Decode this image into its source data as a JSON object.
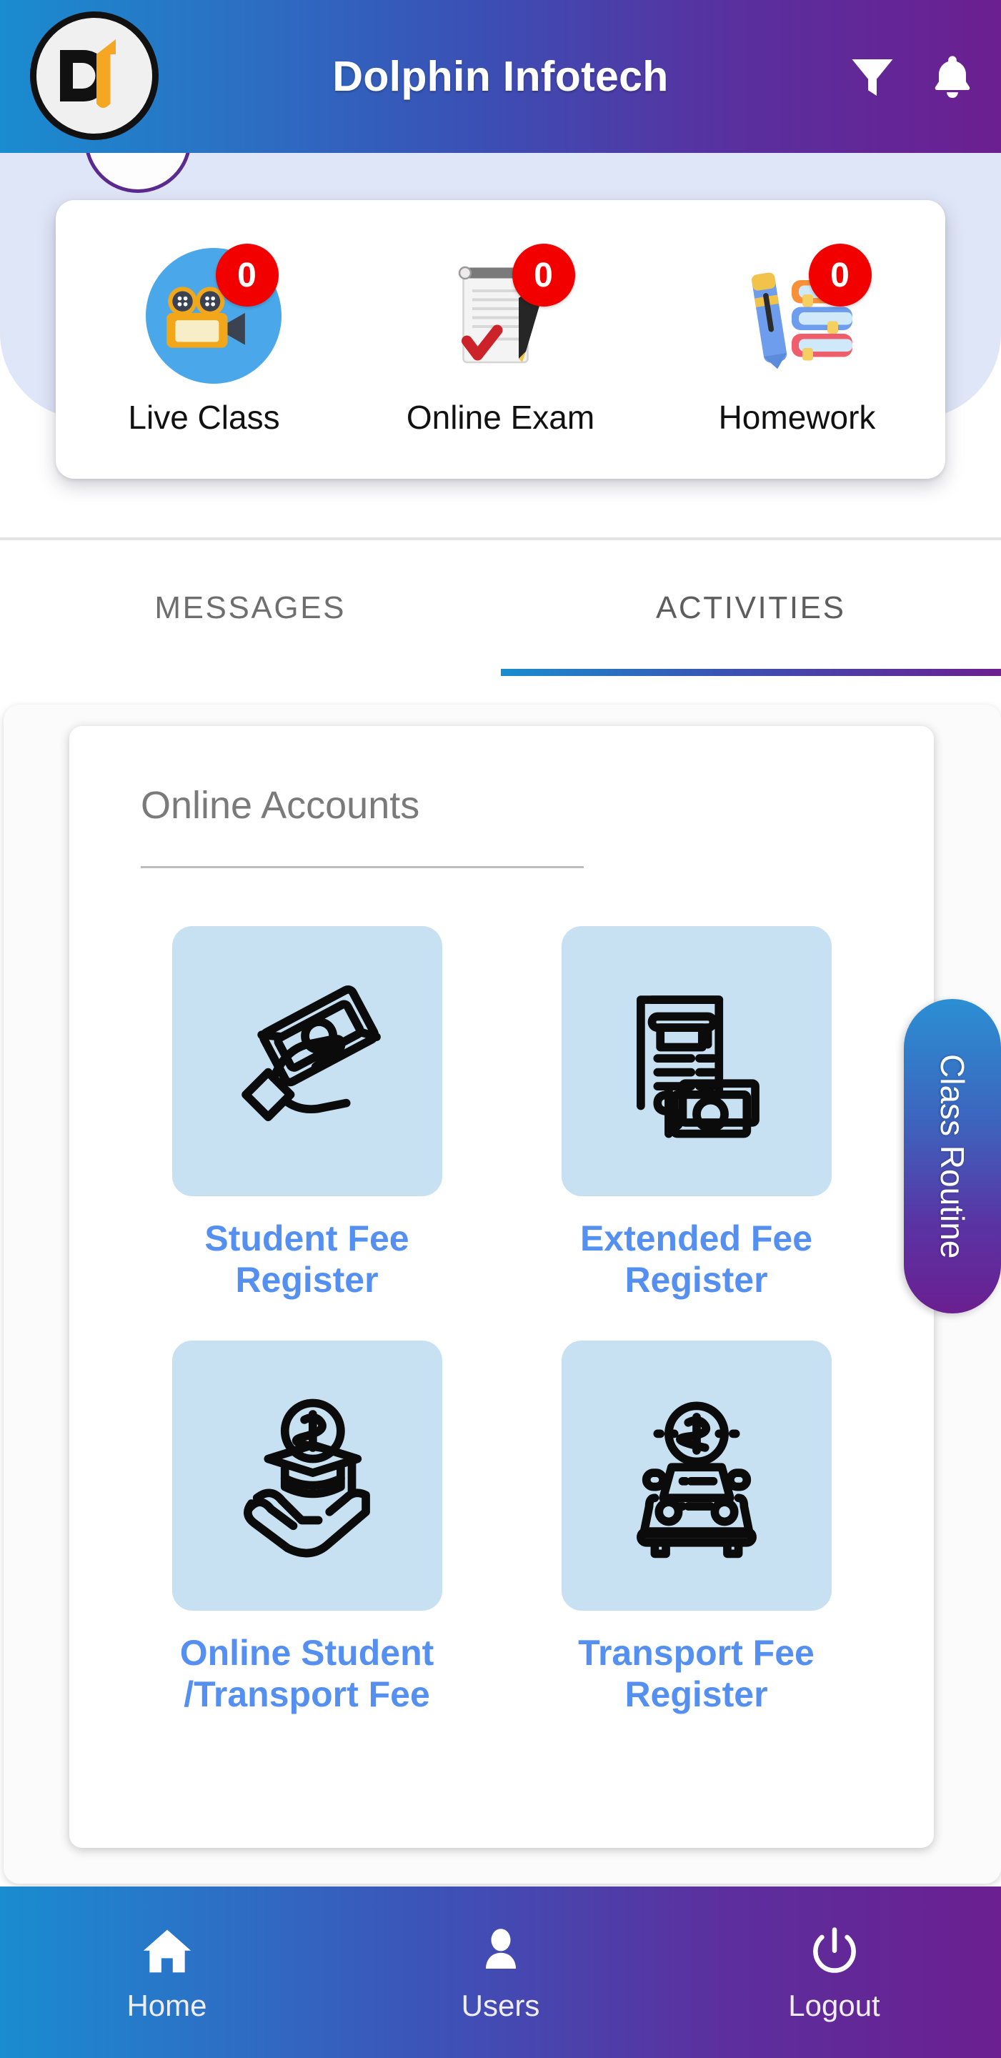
{
  "header": {
    "title": "Dolphin Infotech",
    "logo_alt": "dolphin-infotech-logo",
    "filter_icon": "filter-icon",
    "bell_icon": "bell-icon"
  },
  "quick_actions": [
    {
      "label": "Live Class",
      "badge": "0",
      "icon": "video-camera-icon"
    },
    {
      "label": "Online Exam",
      "badge": "0",
      "icon": "exam-scroll-pen-icon"
    },
    {
      "label": "Homework",
      "badge": "0",
      "icon": "books-pen-icon"
    }
  ],
  "tabs": [
    {
      "label": "MESSAGES",
      "active": false
    },
    {
      "label": "ACTIVITIES",
      "active": true
    }
  ],
  "panel": {
    "title": "Online Accounts",
    "items": [
      {
        "label": "Student Fee Register",
        "icon": "hand-holding-cash-icon"
      },
      {
        "label": "Extended Fee Register",
        "icon": "invoice-cash-icon"
      },
      {
        "label": "Online Student /Transport Fee",
        "icon": "graduation-cap-money-hand-icon"
      },
      {
        "label": "Transport Fee Register",
        "icon": "car-money-icon"
      }
    ]
  },
  "side_tab": {
    "label": "Class Routine"
  },
  "bottom_nav": [
    {
      "label": "Home",
      "icon": "home-icon"
    },
    {
      "label": "Users",
      "icon": "user-icon"
    },
    {
      "label": "Logout",
      "icon": "power-icon"
    }
  ],
  "colors": {
    "gradient_start": "#1a8cd0",
    "gradient_end": "#6b1f90",
    "badge_red": "#f20000",
    "link_blue": "#5590f0",
    "tile_blue": "#c7e1f2",
    "band_lavender": "#dfe6f7"
  }
}
